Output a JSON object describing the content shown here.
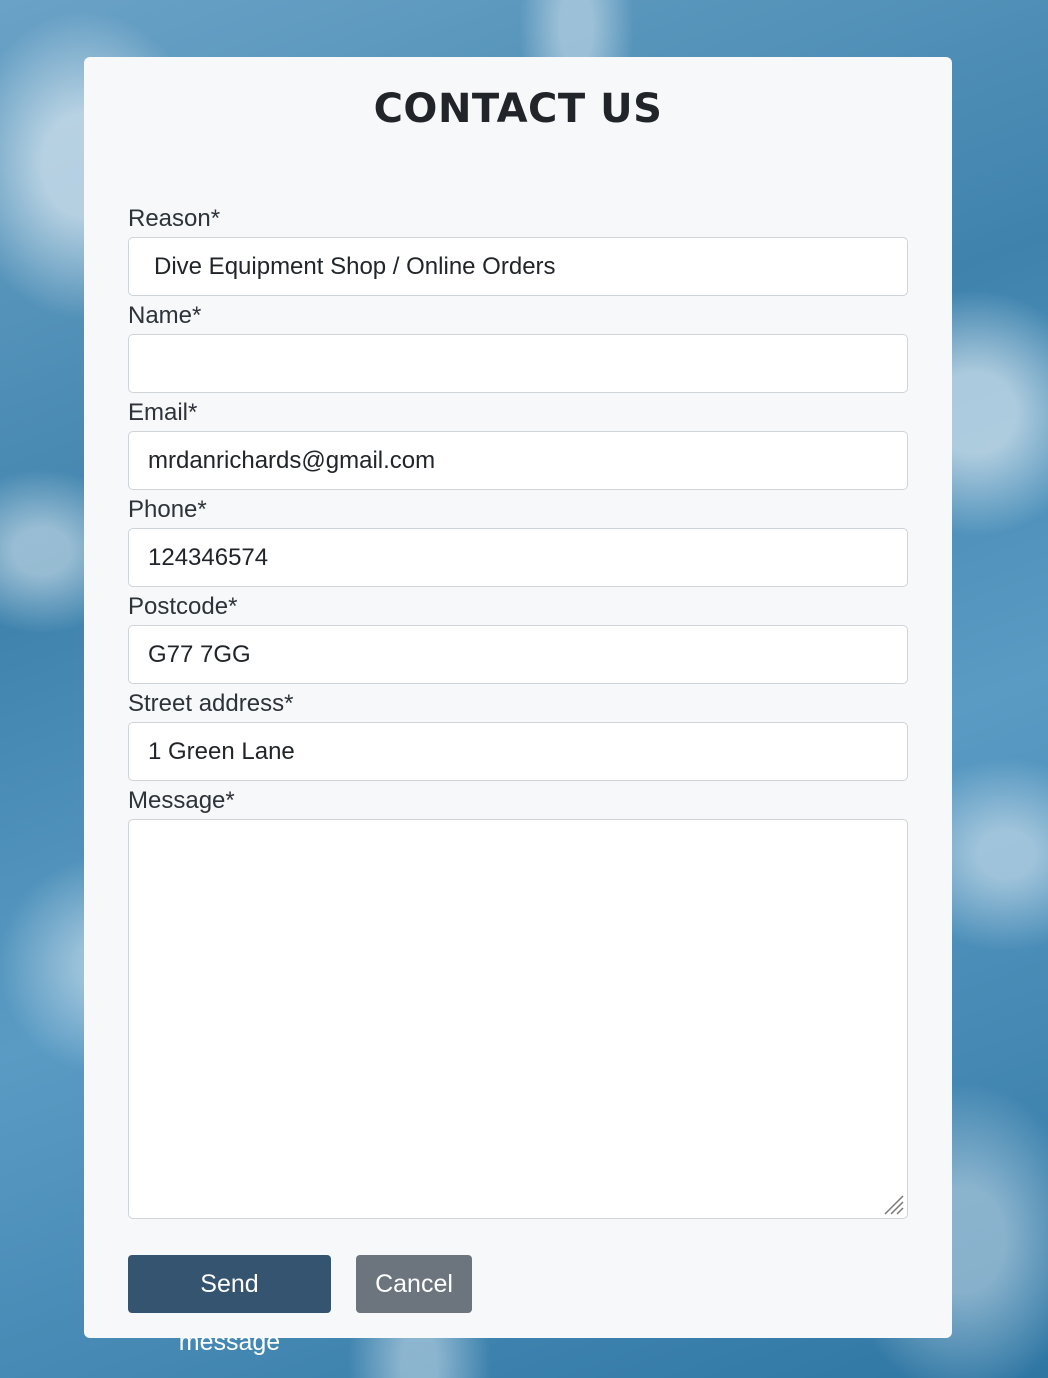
{
  "page": {
    "title": "CONTACT US"
  },
  "form": {
    "reason": {
      "label": "Reason*",
      "value": "Dive Equipment Shop / Online Orders"
    },
    "name": {
      "label": "Name*",
      "value": ""
    },
    "email": {
      "label": "Email*",
      "value": "mrdanrichards@gmail.com"
    },
    "phone": {
      "label": "Phone*",
      "value": "124346574"
    },
    "postcode": {
      "label": "Postcode*",
      "value": "G77 7GG"
    },
    "street": {
      "label": "Street address*",
      "value": "1 Green Lane"
    },
    "message": {
      "label": "Message*",
      "value": ""
    }
  },
  "buttons": {
    "send": "Send message",
    "cancel": "Cancel"
  },
  "colors": {
    "primary_button": "#34546f",
    "secondary_button": "#6c757d",
    "card_background": "#f7f8fa",
    "background_water": "#3f83ad"
  },
  "icons": {
    "resize": "textarea-resize-handle-icon"
  }
}
